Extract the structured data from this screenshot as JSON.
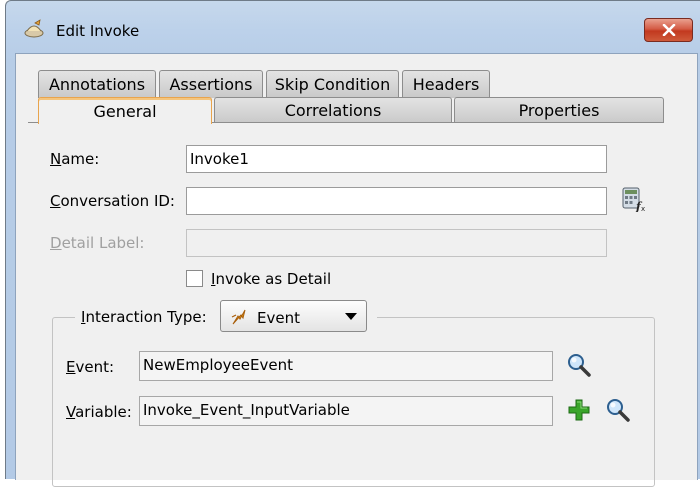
{
  "window": {
    "title": "Edit Invoke",
    "close_icon": "close-x-icon"
  },
  "tabs_row1": [
    {
      "label": "Annotations"
    },
    {
      "label": "Assertions"
    },
    {
      "label": "Skip Condition"
    },
    {
      "label": "Headers"
    }
  ],
  "tabs_row2": [
    {
      "label": "General",
      "active": true
    },
    {
      "label": "Correlations"
    },
    {
      "label": "Properties"
    }
  ],
  "form": {
    "name_label": "Name:",
    "name_value": "Invoke1",
    "conversation_label": "Conversation ID:",
    "conversation_value": "",
    "detail_label": "Detail Label:",
    "detail_value": "",
    "invoke_as_detail_label": "Invoke as Detail",
    "invoke_as_detail_checked": false
  },
  "interaction": {
    "type_label": "Interaction Type:",
    "type_value": "Event",
    "type_icon": "event-lightning-icon",
    "event_label": "Event:",
    "event_value": "NewEmployeeEvent",
    "variable_label": "Variable:",
    "variable_value": "Invoke_Event_InputVariable"
  },
  "colors": {
    "title_bar": "#bcd1ea",
    "close_button": "#c94b32",
    "active_tab_border": "#e8a44d",
    "dialog_bg": "#f0f0f0",
    "add_icon": "#2e9a1d"
  }
}
